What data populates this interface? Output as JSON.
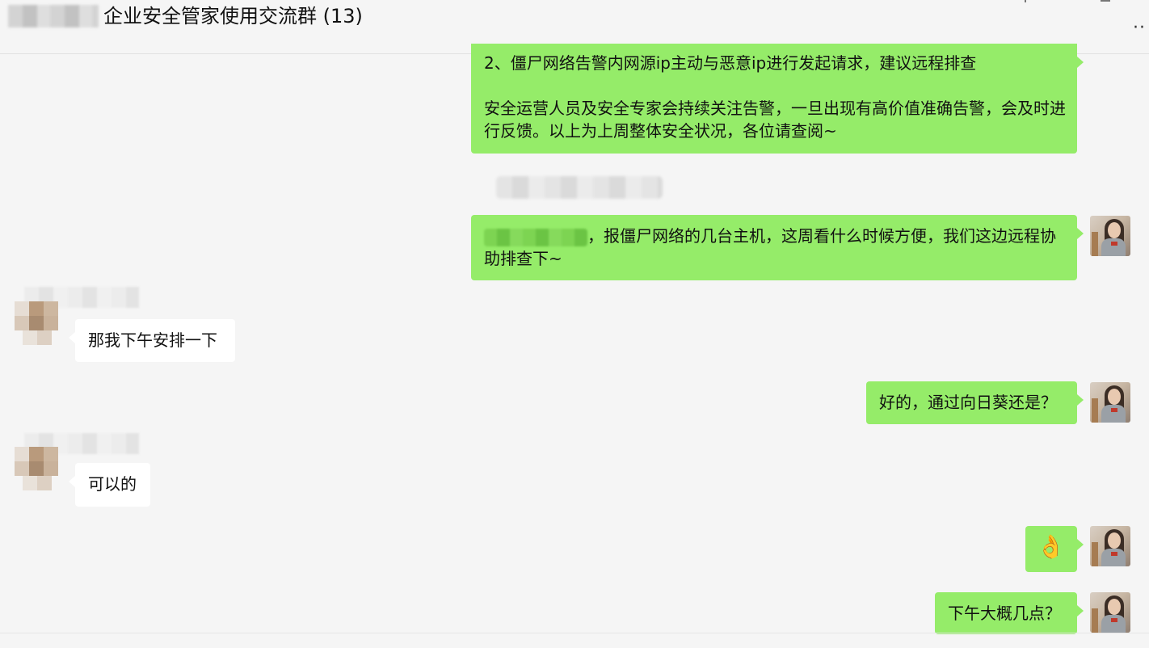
{
  "header": {
    "title": "企业安全管家使用交流群 (13)",
    "more_icon": "more-dots-icon",
    "more_glyph": "··"
  },
  "messages": [
    {
      "side": "me",
      "paragraphs": [
        "2、僵尸网络告警内网源ip主动与恶意ip进行发起请求，建议远程排查",
        "安全运营人员及安全专家会持续关注告警，一旦出现有高价值准确告警，会及时进行反馈。以上为上周整体安全状况，各位请查阅~"
      ]
    },
    {
      "side": "me",
      "text_after_mention": "，报僵尸网络的几台主机，这周看什么时候方便，我们这边远程协助排查下~"
    },
    {
      "side": "other",
      "text": "那我下午安排一下"
    },
    {
      "side": "me",
      "text": "好的，通过向日葵还是？"
    },
    {
      "side": "other",
      "text": "可以的"
    },
    {
      "side": "me",
      "emoji": "👌",
      "emoji_name": "ok-hand-emoji"
    },
    {
      "side": "me",
      "text": "下午大概几点？"
    }
  ],
  "colors": {
    "my_bubble": "#95ec69",
    "other_bubble": "#ffffff",
    "background": "#f5f5f5"
  }
}
